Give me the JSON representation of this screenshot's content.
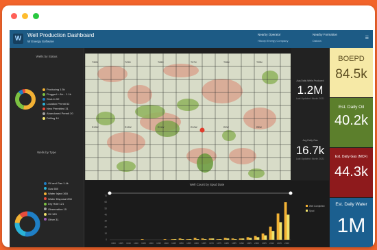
{
  "dashboard": {
    "title": "Well Production Dashboard",
    "subtitle": "W Energy Software",
    "logo": "W"
  },
  "header": {
    "filter1_label": "Nearby Operator",
    "filter1_value": "Hilcorp Energy Company",
    "filter2_label": "Nearby Formation",
    "filter2_value": "Dakota"
  },
  "wells_by_status": {
    "title": "Wells by Status",
    "items": [
      {
        "label": "Producing 1.5k",
        "color": "#f2b134"
      },
      {
        "label": "Plugged + Ab... 1.1k",
        "color": "#7cc142"
      },
      {
        "label": "Shut-In 52",
        "color": "#1f7fc6"
      },
      {
        "label": "Location Permit 52",
        "color": "#2ab3d8"
      },
      {
        "label": "New Permitted 31",
        "color": "#e84c3d"
      },
      {
        "label": "Abandoned Permit 20",
        "color": "#a0a0a0"
      },
      {
        "label": "Drilling 14",
        "color": "#f0e36c"
      }
    ]
  },
  "wells_by_type": {
    "title": "Wells by Type",
    "items": [
      {
        "label": "Oil and Gas 1.4k",
        "color": "#1f7fc6"
      },
      {
        "label": "Gas 650",
        "color": "#2ab3d8"
      },
      {
        "label": "Water Inject 365",
        "color": "#f2b134"
      },
      {
        "label": "Water Disposal 208",
        "color": "#e84c3d"
      },
      {
        "label": "Dry Hole 121",
        "color": "#7cc142"
      },
      {
        "label": "Observation 15",
        "color": "#a0a0a0"
      },
      {
        "label": "Oil 163",
        "color": "#f0e36c"
      },
      {
        "label": "Other 31",
        "color": "#9b59b6"
      }
    ]
  },
  "stats": {
    "top_label": "Avg Daily Wells Produced",
    "top_value": "1.2M",
    "top_sub": "Last Updated: Month 2021",
    "bottom_label": "Avg Daily Gas",
    "bottom_value": "16.7k",
    "bottom_sub": "Last Updated: Month 2021"
  },
  "kpis": [
    {
      "label": "BOEPD",
      "value": "84.5k",
      "bg": "#f6e9a6",
      "fg": "#5a4b1f"
    },
    {
      "label": "Est. Daily Oil",
      "value": "40.2k",
      "bg": "#5c7f2c",
      "fg": "#ffffff"
    },
    {
      "label": "Est. Daily Gas (MCF)",
      "value": "44.3k",
      "bg": "#8e1a1c",
      "fg": "#ffffff"
    },
    {
      "label": "Est. Daily Water",
      "value": "1M",
      "bg": "#1b5f8f",
      "fg": "#ffffff"
    }
  ],
  "chart_data": {
    "type": "bar",
    "title": "Well Count by Spud Date",
    "legend": [
      "Well Completed",
      "Spud"
    ],
    "ylim": [
      0,
      70
    ],
    "ytick_labels": [
      "70",
      "60",
      "50",
      "40",
      "30",
      "20",
      "10",
      "0"
    ],
    "xtick_labels": [
      "1900",
      "1905",
      "1910",
      "1920",
      "1925",
      "1930",
      "1935",
      "1940",
      "1945",
      "1950",
      "1955",
      "1960",
      "1965",
      "1970",
      "1975",
      "1980",
      "1985",
      "1990",
      "1995",
      "2000",
      "2005",
      "2010",
      "2015",
      "2020"
    ],
    "series": [
      {
        "name": "Well Completed",
        "color": "#f2b134",
        "values": [
          0,
          0,
          0,
          0,
          1,
          0,
          0,
          1,
          1,
          2,
          1,
          3,
          2,
          2,
          1,
          3,
          2,
          2,
          4,
          6,
          10,
          21,
          42,
          60
        ]
      },
      {
        "name": "Spud",
        "color": "#f0e36c",
        "values": [
          0,
          0,
          0,
          0,
          0,
          0,
          0,
          0,
          1,
          1,
          1,
          1,
          1,
          2,
          1,
          2,
          1,
          2,
          3,
          4,
          7,
          14,
          28,
          40
        ]
      }
    ]
  },
  "map": {
    "tile_labels": [
      "T30N",
      "T29N",
      "T28N",
      "T27N",
      "T26N",
      "T25N",
      "R13W",
      "R12W",
      "R11W",
      "R10W",
      "R9W",
      "R8W"
    ]
  }
}
